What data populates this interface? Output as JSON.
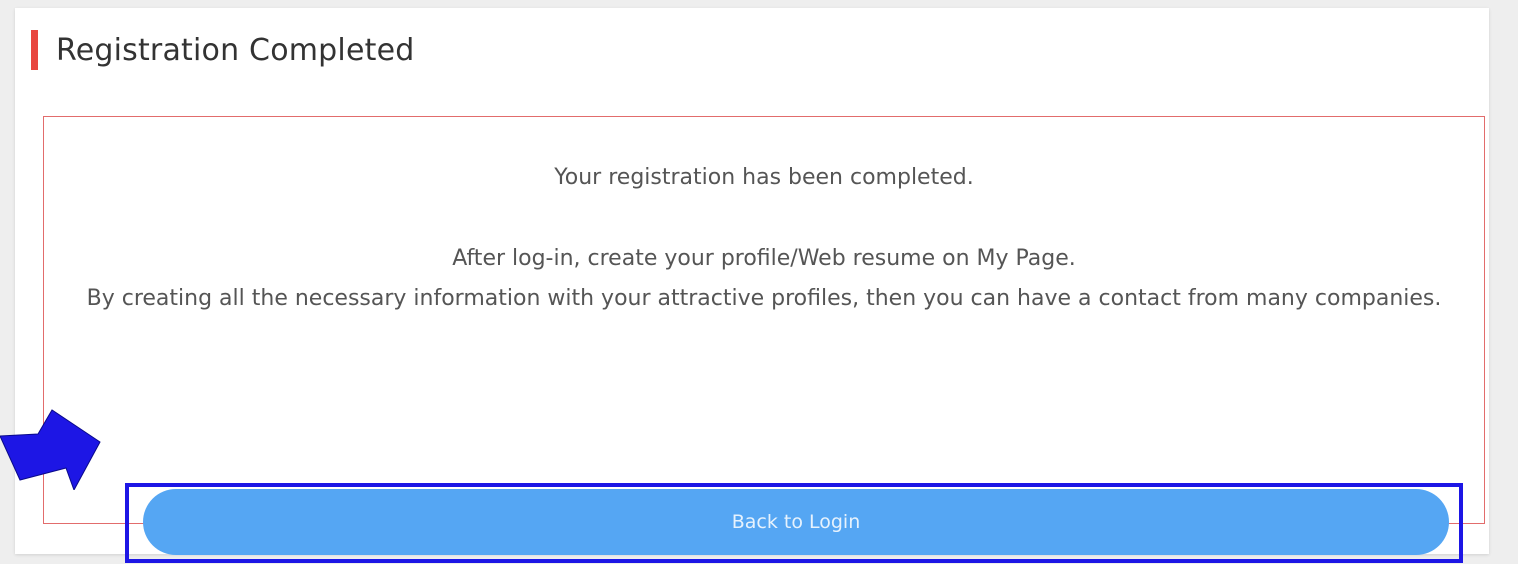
{
  "page": {
    "title": "Registration Completed"
  },
  "message": {
    "line1": "Your registration has been completed.",
    "line2": "After log-in, create your profile/Web resume on My Page.",
    "line3": "By creating all the necessary information with your attractive profiles, then you can have a contact from many companies."
  },
  "actions": {
    "back_to_login_label": "Back to Login"
  },
  "colors": {
    "accent_bar": "#e8463f",
    "message_border": "#e26c6c",
    "button_bg": "#55a6f3",
    "highlight_border": "#1d16e5",
    "arrow": "#1d16e5"
  },
  "annotations": {
    "pointer_icon": "arrow-right-icon"
  }
}
